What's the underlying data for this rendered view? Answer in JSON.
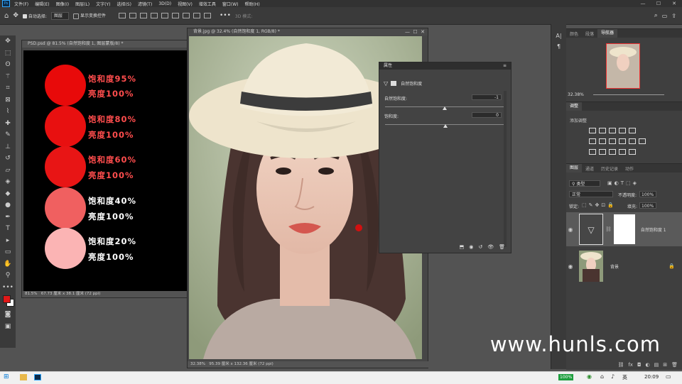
{
  "app": {
    "icon_label": "Ps"
  },
  "menu": [
    "文件(F)",
    "编辑(E)",
    "图像(I)",
    "图层(L)",
    "文字(Y)",
    "选择(S)",
    "滤镜(T)",
    "3D(D)",
    "视图(V)",
    "增效工具",
    "窗口(W)",
    "帮助(H)"
  ],
  "window_controls": [
    "—",
    "☐",
    "✕"
  ],
  "options": {
    "auto_select": "自动选择:",
    "auto_select_value": "图层",
    "show_transform": "显示变换控件",
    "mode_3d": "3D 模式:"
  },
  "doc1": {
    "tab": "PSD.psd @ 81.5% (自然饱和度 1, 图层蒙版/8) *",
    "status_zoom": "81.5%",
    "status_size": "67.73 厘米 x 38.1 厘米 (72 ppi)",
    "items": [
      {
        "saturation": "饱和度95%",
        "brightness": "亮度100%",
        "color": "#e80a0a"
      },
      {
        "saturation": "饱和度80%",
        "brightness": "亮度100%",
        "color": "#e81010"
      },
      {
        "saturation": "饱和度60%",
        "brightness": "亮度100%",
        "color": "#e81515"
      },
      {
        "saturation": "饱和度40%",
        "brightness": "亮度100%",
        "color": "#f06060"
      },
      {
        "saturation": "饱和度20%",
        "brightness": "亮度100%",
        "color": "#fbb4b4"
      }
    ]
  },
  "doc2": {
    "tab": "背景.jpg @ 32.4% (自然饱和度 1, RGB/8) *",
    "status_zoom": "32.38%",
    "status_size": "95.39 厘米 x 132.36 厘米 (72 ppi)"
  },
  "properties": {
    "title": "属性",
    "type": "自然饱和度",
    "vibrance_label": "自然饱和度:",
    "vibrance_value": "-1",
    "vibrance_level": -1,
    "saturation_label": "饱和度:",
    "saturation_value": "0",
    "saturation_level": 0
  },
  "navigator": {
    "tabs": [
      "颜色",
      "段落",
      "导航器"
    ],
    "zoom": "32.38%"
  },
  "adjustments": {
    "title": "调整",
    "add_label": "添加调整"
  },
  "layers_panel": {
    "tabs": [
      "图层",
      "通道",
      "历史记录",
      "动作"
    ],
    "filter_kind": "类型",
    "blend_mode": "正常",
    "opacity_label": "不透明度:",
    "opacity_value": "100%",
    "lock_label": "锁定:",
    "fill_label": "填充:",
    "fill_value": "100%",
    "layers": [
      {
        "name": "自然饱和度 1"
      },
      {
        "name": "背景"
      }
    ]
  },
  "taskbar": {
    "battery": "100%",
    "ime": "英",
    "time": "20:09"
  },
  "watermark": "www.hunls.com",
  "colors": {
    "foreground": "#e01818",
    "background": "#ffffff",
    "accent": "#31a8ff"
  }
}
